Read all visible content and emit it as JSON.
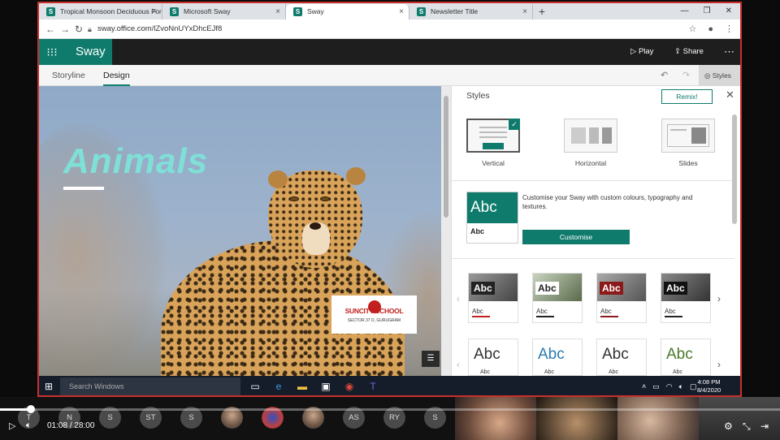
{
  "browser": {
    "tabs": [
      {
        "label": "Tropical Monsoon Deciduous For",
        "active": false
      },
      {
        "label": "Microsoft Sway",
        "active": false
      },
      {
        "label": "Sway",
        "active": true
      },
      {
        "label": "Newsletter Title",
        "active": false
      }
    ],
    "url": "sway.office.com/lZvoNnUYxDhcEJf8"
  },
  "sway": {
    "brand": "Sway",
    "play": "Play",
    "share": "Share",
    "tabs": [
      "Storyline",
      "Design"
    ],
    "styles_button": "Styles"
  },
  "canvas": {
    "title": "Animals",
    "logo_name": "SUNCITY SCHOOL",
    "logo_sub": "SECTOR 37 D, GURUGRAM"
  },
  "pane": {
    "title": "Styles",
    "remix": "Remix!",
    "layouts": [
      "Vertical",
      "Horizontal",
      "Slides"
    ],
    "custom_text": "Customise your Sway with custom colours, typography and textures.",
    "customise_btn": "Customise",
    "abc_big": "Abc",
    "abc_small": "Abc"
  },
  "taskbar": {
    "search_placeholder": "Search Windows",
    "time": "4:08 PM",
    "date": "8/4/2020"
  },
  "meeting": {
    "participants": [
      "N",
      "S",
      "ST",
      "S",
      "AS",
      "RY",
      "S"
    ],
    "current_time": "01:08",
    "separator": "/",
    "duration": "28:00",
    "progress": 0.04
  },
  "colors": {
    "accent": "#0f7b6c",
    "title_text": "#7fe0d8",
    "frame_border": "#c9302c"
  }
}
